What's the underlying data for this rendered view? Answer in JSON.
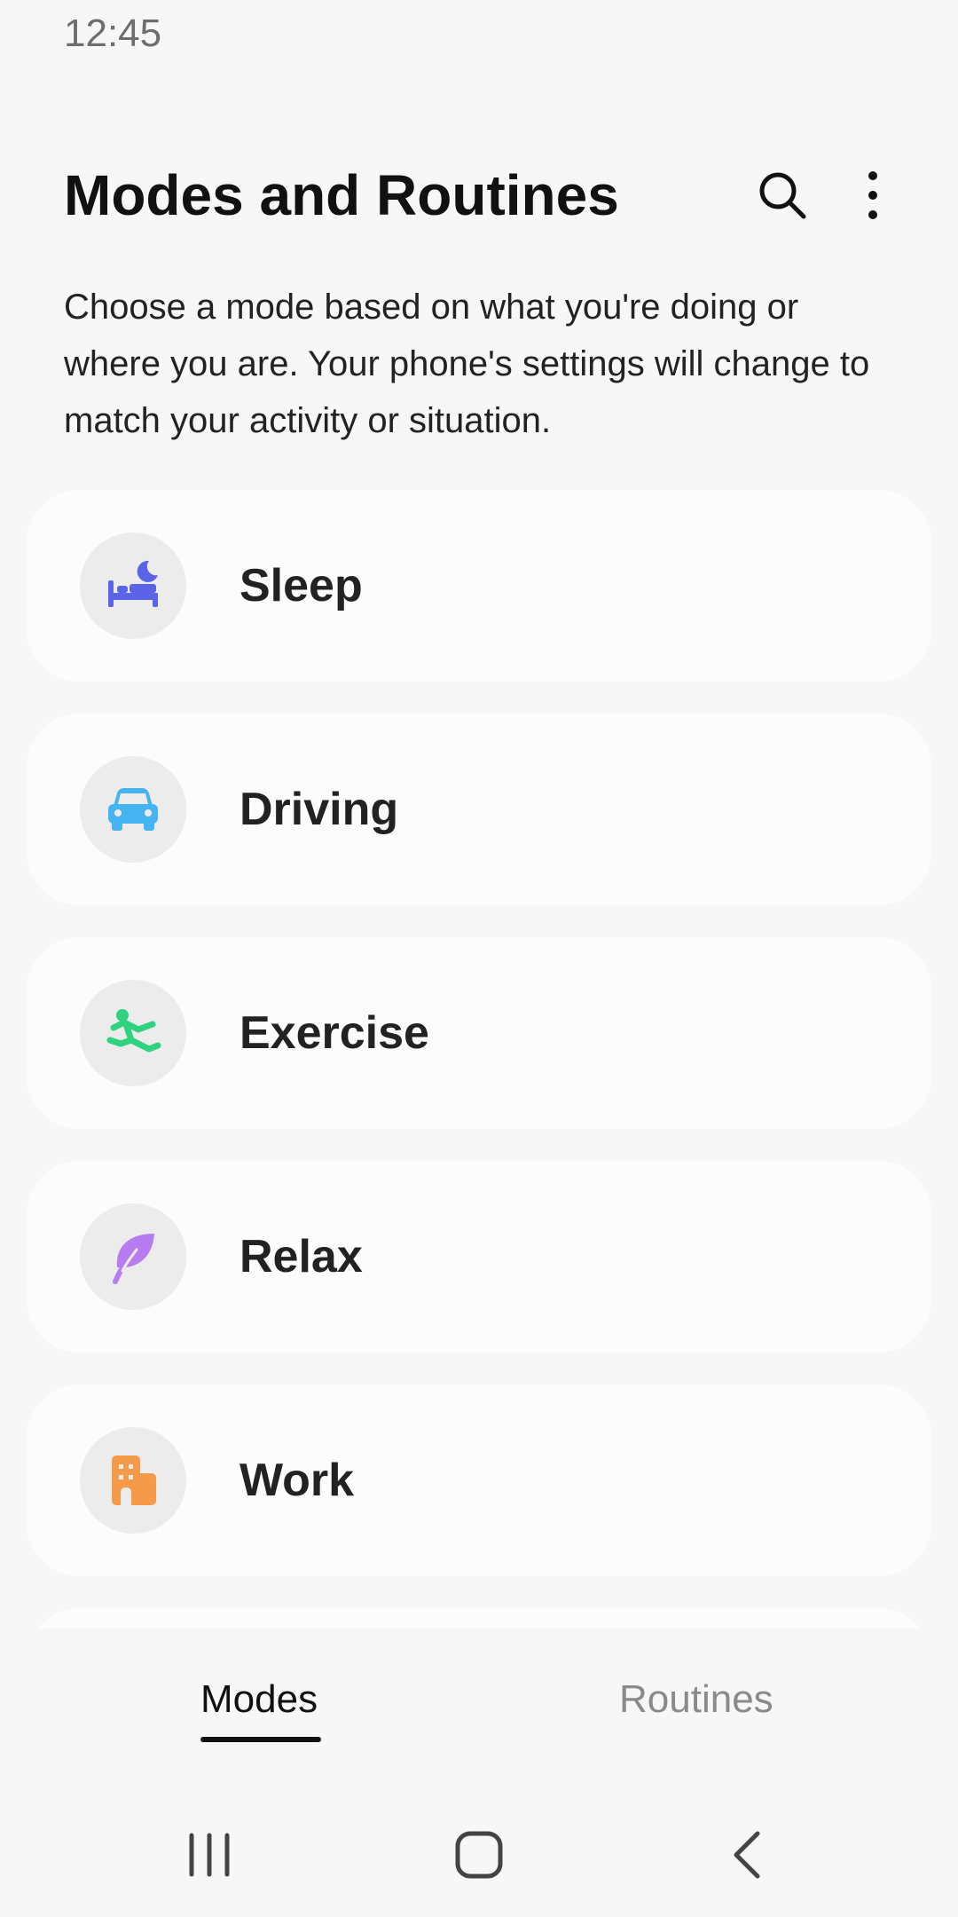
{
  "status_bar": {
    "time": "12:45"
  },
  "header": {
    "title": "Modes and Routines",
    "search_icon": "search-icon",
    "more_icon": "more-vertical-icon"
  },
  "description": "Choose a mode based on what you're doing or where you are. Your phone's settings will change to match your activity or situation.",
  "modes": [
    {
      "label": "Sleep",
      "icon": "bed-moon-icon",
      "color": "#5b63e6"
    },
    {
      "label": "Driving",
      "icon": "car-icon",
      "color": "#45b4f0"
    },
    {
      "label": "Exercise",
      "icon": "running-person-icon",
      "color": "#2fd27f"
    },
    {
      "label": "Relax",
      "icon": "leaf-icon",
      "color": "#b77cf0"
    },
    {
      "label": "Work",
      "icon": "building-icon",
      "color": "#f59a48"
    }
  ],
  "tabs": [
    {
      "label": "Modes",
      "selected": true
    },
    {
      "label": "Routines",
      "selected": false
    }
  ],
  "nav_bar": {
    "recents_icon": "recents-icon",
    "home_icon": "home-icon",
    "back_icon": "back-icon"
  }
}
